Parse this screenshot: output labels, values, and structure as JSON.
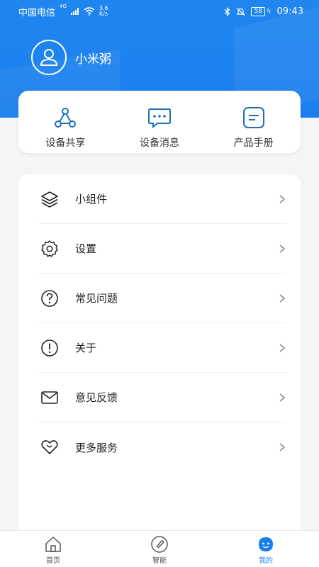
{
  "status_bar": {
    "carrier": "中国电信",
    "network": "4G",
    "speed_value": "3.6",
    "speed_unit": "K/s",
    "battery": "58",
    "time": "09:43"
  },
  "profile": {
    "username": "小米粥"
  },
  "quick_actions": [
    {
      "label": "设备共享",
      "icon": "share-icon"
    },
    {
      "label": "设备消息",
      "icon": "message-icon"
    },
    {
      "label": "产品手册",
      "icon": "manual-icon"
    }
  ],
  "menu": [
    {
      "label": "小组件",
      "icon": "layers-icon"
    },
    {
      "label": "设置",
      "icon": "gear-icon"
    },
    {
      "label": "常见问题",
      "icon": "question-icon"
    },
    {
      "label": "关于",
      "icon": "info-icon"
    },
    {
      "label": "意见反馈",
      "icon": "mail-icon"
    },
    {
      "label": "更多服务",
      "icon": "heart-icon"
    }
  ],
  "tabbar": [
    {
      "label": "首页",
      "icon": "home-icon"
    },
    {
      "label": "智能",
      "icon": "smart-icon"
    },
    {
      "label": "我的",
      "icon": "me-icon",
      "active": true
    }
  ],
  "colors": {
    "primary": "#1a7fee",
    "accent_icon": "#1e6fb8"
  }
}
